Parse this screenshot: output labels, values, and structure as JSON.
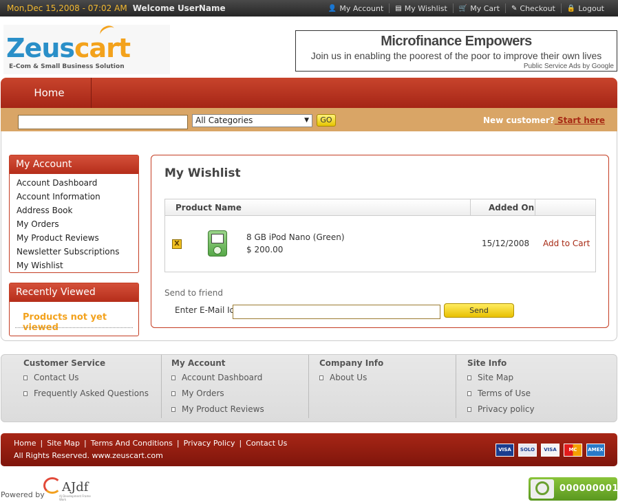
{
  "topbar": {
    "date": "Mon,Dec 15,2008 - 07:02 AM",
    "welcome": "Welcome UserName",
    "links": [
      {
        "icon": "user-icon",
        "glyph": "👤",
        "label": "My Account"
      },
      {
        "icon": "list-icon",
        "glyph": "▤",
        "label": "My Wishlist"
      },
      {
        "icon": "cart-icon",
        "glyph": "🛒",
        "label": "My Cart"
      },
      {
        "icon": "checkout-icon",
        "glyph": "✎",
        "label": "Checkout"
      },
      {
        "icon": "lock-icon",
        "glyph": "🔒",
        "label": "Logout"
      }
    ]
  },
  "logo": {
    "text_a": "Zeus",
    "text_b": "cart",
    "tagline": "E-Com & Small Business Solution"
  },
  "ad": {
    "title": "Microfinance Empowers",
    "desc": "Join us in enabling the poorest of the poor to improve their own lives",
    "source": "Public Service Ads by Google"
  },
  "nav": {
    "home": "Home"
  },
  "search": {
    "category": "All Categories",
    "go": "GO",
    "new_customer": "New customer?",
    "start_here": " Start here"
  },
  "sidebar": {
    "account_title": "My Account",
    "items": [
      "Account Dashboard",
      "Account Information",
      "Address Book",
      "My Orders",
      "My Product Reviews",
      "Newsletter Subscriptions",
      "My Wishlist"
    ],
    "recent_title": "Recently Viewed",
    "recent_empty": "Products not yet viewed"
  },
  "wishlist": {
    "title": "My Wishlist",
    "col_product": "Product Name",
    "col_added": "Added On",
    "item": {
      "name": "8 GB iPod Nano (Green)",
      "price": "$ 200.00",
      "added": "15/12/2008",
      "action": "Add to Cart",
      "remove": "X"
    },
    "send_title": "Send to friend",
    "email_label": "Enter E-Mail Id",
    "send_button": "Send"
  },
  "footer": {
    "columns": [
      {
        "title": "Customer Service",
        "items": [
          "Contact Us",
          "Frequently Asked Questions"
        ]
      },
      {
        "title": "My Account",
        "items": [
          "Account Dashboard",
          "My Orders",
          "My Product Reviews"
        ]
      },
      {
        "title": "Company Info",
        "items": [
          "About Us"
        ]
      },
      {
        "title": "Site Info",
        "items": [
          "Site Map",
          "Terms of Use",
          "Privacy policy"
        ]
      }
    ],
    "bottom_links": [
      "Home",
      "Site Map",
      "Terms And Conditions",
      "Privacy Policy",
      "Contact Us"
    ],
    "copyright": "All Rights Reserved. www.zeuscart.com",
    "cards": [
      "VISA",
      "SOLO",
      "VISA",
      "MC",
      "AMEX"
    ],
    "powered_by": "Powered by",
    "ajdf": "AJdf",
    "ajdf_sub": "AJ Development Frame Work",
    "counter": "000000001"
  }
}
